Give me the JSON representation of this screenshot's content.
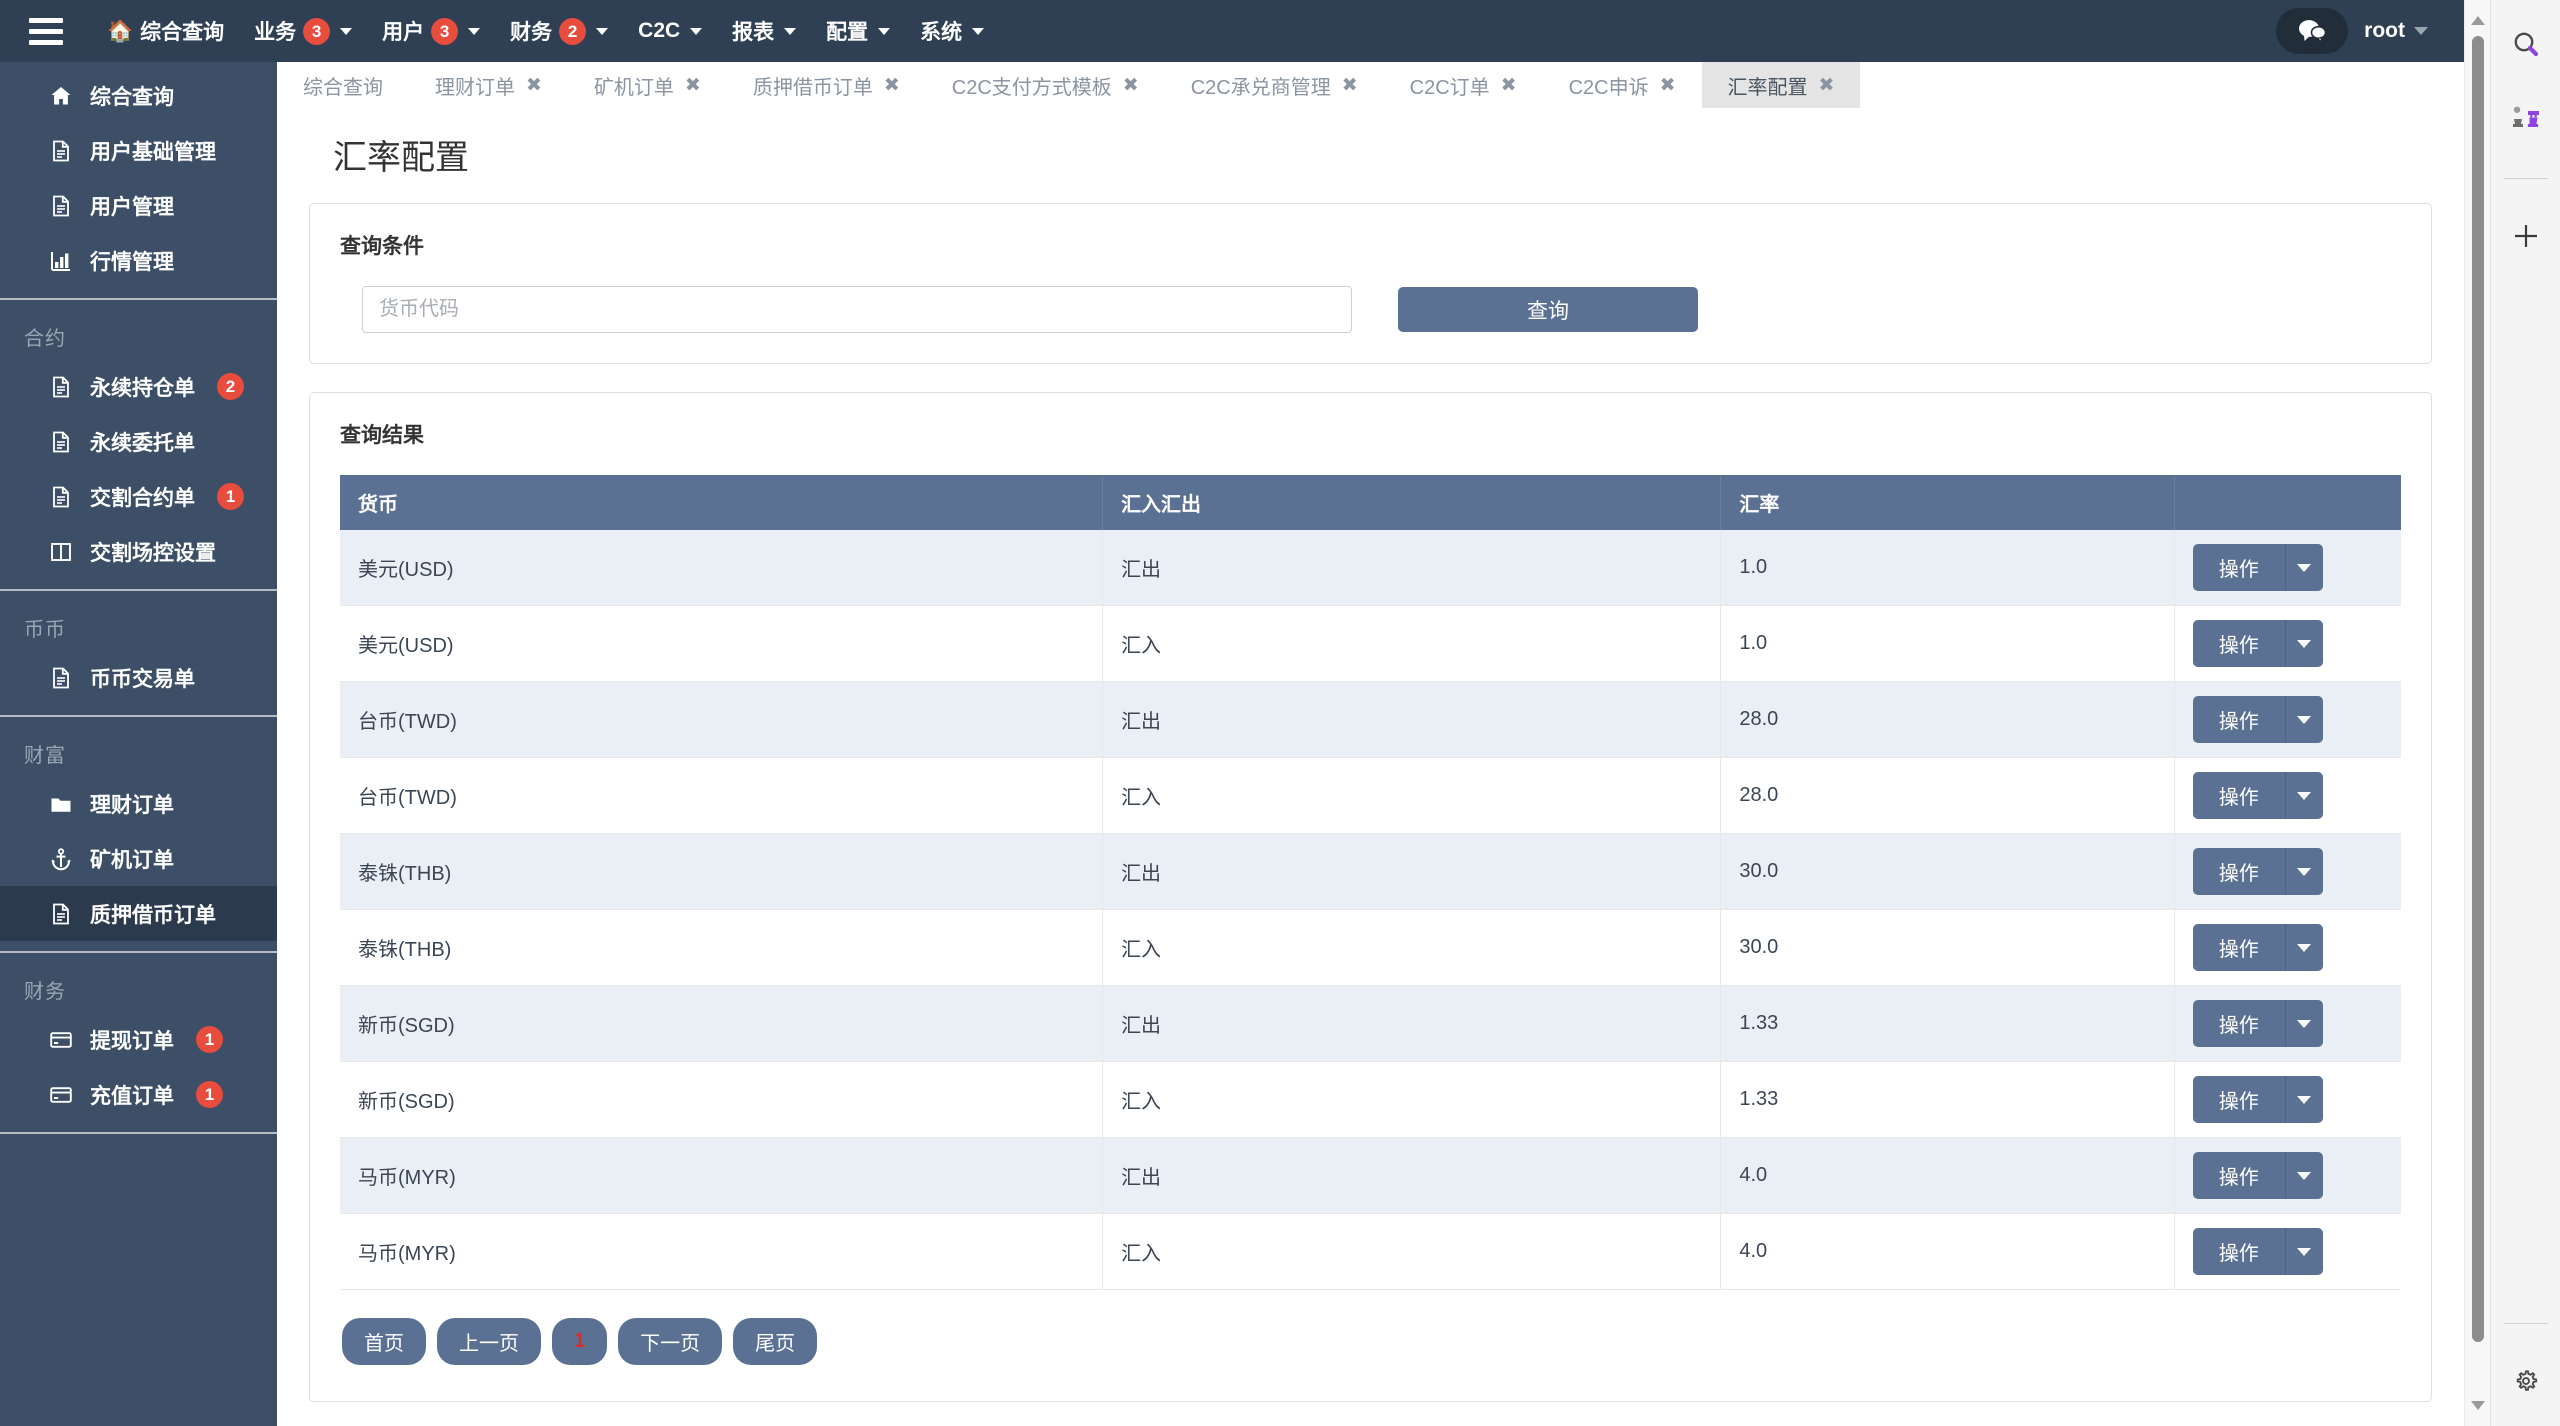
{
  "topnav": {
    "menu_icon": "hamburger-icon",
    "home_icon": "home-icon",
    "items": [
      {
        "label": "综合查询",
        "badge": "",
        "caret": false,
        "home": true
      },
      {
        "label": "业务",
        "badge": "3",
        "caret": true,
        "home": false
      },
      {
        "label": "用户",
        "badge": "3",
        "caret": true,
        "home": false
      },
      {
        "label": "财务",
        "badge": "2",
        "caret": true,
        "home": false
      },
      {
        "label": "C2C",
        "badge": "",
        "caret": true,
        "home": false
      },
      {
        "label": "报表",
        "badge": "",
        "caret": true,
        "home": false
      },
      {
        "label": "配置",
        "badge": "",
        "caret": true,
        "home": false
      },
      {
        "label": "系统",
        "badge": "",
        "caret": true,
        "home": false
      }
    ],
    "chat_icon": "chat-bubbles-icon",
    "user_label": "root"
  },
  "sidebar": {
    "groups": [
      {
        "title": "",
        "items": [
          {
            "label": "综合查询",
            "icon": "home-icon",
            "badge": "",
            "active": false
          },
          {
            "label": "用户基础管理",
            "icon": "document-icon",
            "badge": "",
            "active": false
          },
          {
            "label": "用户管理",
            "icon": "document-icon",
            "badge": "",
            "active": false
          },
          {
            "label": "行情管理",
            "icon": "bar-chart-icon",
            "badge": "",
            "active": false
          }
        ]
      },
      {
        "title": "合约",
        "items": [
          {
            "label": "永续持仓单",
            "icon": "document-icon",
            "badge": "2",
            "active": false
          },
          {
            "label": "永续委托单",
            "icon": "document-icon",
            "badge": "",
            "active": false
          },
          {
            "label": "交割合约单",
            "icon": "document-icon",
            "badge": "1",
            "active": false
          },
          {
            "label": "交割场控设置",
            "icon": "columns-icon",
            "badge": "",
            "active": false
          }
        ]
      },
      {
        "title": "币币",
        "items": [
          {
            "label": "币币交易单",
            "icon": "document-icon",
            "badge": "",
            "active": false
          }
        ]
      },
      {
        "title": "财富",
        "items": [
          {
            "label": "理财订单",
            "icon": "folder-icon",
            "badge": "",
            "active": false
          },
          {
            "label": "矿机订单",
            "icon": "anchor-icon",
            "badge": "",
            "active": false
          },
          {
            "label": "质押借币订单",
            "icon": "document-icon",
            "badge": "",
            "active": true
          }
        ]
      },
      {
        "title": "财务",
        "items": [
          {
            "label": "提现订单",
            "icon": "credit-card-icon",
            "badge": "1",
            "active": false
          },
          {
            "label": "充值订单",
            "icon": "credit-card-icon",
            "badge": "1",
            "active": false
          }
        ]
      }
    ]
  },
  "tabs": {
    "items": [
      {
        "label": "综合查询",
        "closable": false,
        "active": false
      },
      {
        "label": "理财订单",
        "closable": true,
        "active": false
      },
      {
        "label": "矿机订单",
        "closable": true,
        "active": false
      },
      {
        "label": "质押借币订单",
        "closable": true,
        "active": false
      },
      {
        "label": "C2C支付方式模板",
        "closable": true,
        "active": false
      },
      {
        "label": "C2C承兑商管理",
        "closable": true,
        "active": false
      },
      {
        "label": "C2C订单",
        "closable": true,
        "active": false
      },
      {
        "label": "C2C申诉",
        "closable": true,
        "active": false
      },
      {
        "label": "汇率配置",
        "closable": true,
        "active": true
      }
    ],
    "close_glyph": "✖",
    "refresh_icon": "refresh-icon"
  },
  "page": {
    "title": "汇率配置"
  },
  "query_panel": {
    "title": "查询条件",
    "input_placeholder": "货币代码",
    "input_value": "",
    "submit_label": "查询"
  },
  "result_panel": {
    "title": "查询结果",
    "columns": [
      "货币",
      "汇入汇出",
      "汇率",
      ""
    ],
    "action_label": "操作",
    "rows": [
      {
        "currency": "美元(USD)",
        "direction": "汇出",
        "rate": "1.0"
      },
      {
        "currency": "美元(USD)",
        "direction": "汇入",
        "rate": "1.0"
      },
      {
        "currency": "台币(TWD)",
        "direction": "汇出",
        "rate": "28.0"
      },
      {
        "currency": "台币(TWD)",
        "direction": "汇入",
        "rate": "28.0"
      },
      {
        "currency": "泰铢(THB)",
        "direction": "汇出",
        "rate": "30.0"
      },
      {
        "currency": "泰铢(THB)",
        "direction": "汇入",
        "rate": "30.0"
      },
      {
        "currency": "新币(SGD)",
        "direction": "汇出",
        "rate": "1.33"
      },
      {
        "currency": "新币(SGD)",
        "direction": "汇入",
        "rate": "1.33"
      },
      {
        "currency": "马币(MYR)",
        "direction": "汇出",
        "rate": "4.0"
      },
      {
        "currency": "马币(MYR)",
        "direction": "汇入",
        "rate": "4.0"
      }
    ]
  },
  "pagination": {
    "first": "首页",
    "prev": "上一页",
    "current": "1",
    "next": "下一页",
    "last": "尾页"
  },
  "right_rail": {
    "items": [
      {
        "icon": "search-icon"
      },
      {
        "icon": "chess-pieces-icon"
      },
      {
        "icon": "plus-icon"
      },
      {
        "icon": "gear-icon"
      }
    ]
  },
  "colors": {
    "nav_bg": "#2f4054",
    "sidebar_bg": "#3c4f66",
    "accent": "#5b7193",
    "badge_red": "#e74c3c",
    "row_alt": "#eaeef5",
    "current_page_red": "#d32f2f"
  }
}
